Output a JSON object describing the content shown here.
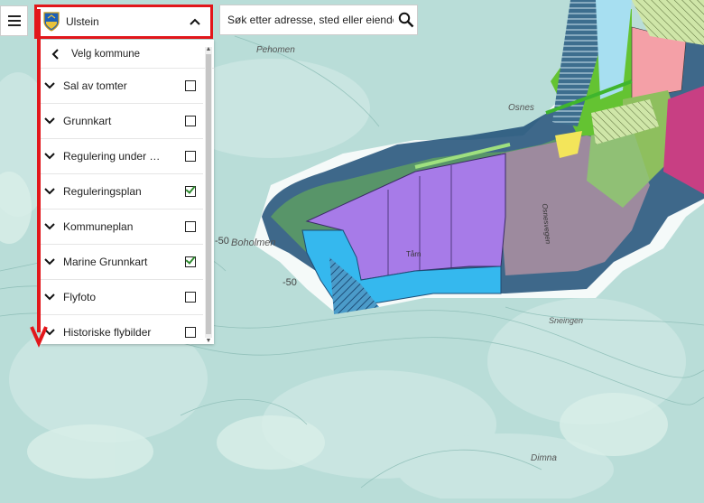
{
  "map": {
    "place_labels": [
      "Pehomen",
      "Osnes",
      "Boholmen",
      "Sneingen",
      "Dimna",
      "Tårn",
      "Osnesvegen"
    ],
    "depth_labels": [
      "-50",
      "-50"
    ],
    "colors": {
      "sea": "#b9ddd8",
      "regulation_purple": "#a77be8",
      "water_blue": "#35b8ee",
      "dark_border": "#1d4d77",
      "green_zone": "#64c332",
      "pink_zone": "#f4a0a7",
      "magenta_zone": "#c83f83"
    }
  },
  "menu_button": {
    "icon": "hamburger-icon"
  },
  "municipality": {
    "name": "Ulstein",
    "icon": "shield-icon",
    "toggle_icon": "chevron-up-icon",
    "highlight_color": "#e2171b"
  },
  "search": {
    "placeholder": "Søk etter adresse, sted eller eiendom",
    "icon": "search-icon"
  },
  "layer_panel": {
    "back_label": "Velg kommune",
    "layers": [
      {
        "label": "Sal av tomter",
        "checked": false
      },
      {
        "label": "Grunnkart",
        "checked": false
      },
      {
        "label": "Regulering under …",
        "checked": false
      },
      {
        "label": "Reguleringsplan",
        "checked": true
      },
      {
        "label": "Kommuneplan",
        "checked": false
      },
      {
        "label": "Marine Grunnkart",
        "checked": true
      },
      {
        "label": "Flyfoto",
        "checked": false
      },
      {
        "label": "Historiske flybilder",
        "checked": false
      }
    ]
  }
}
